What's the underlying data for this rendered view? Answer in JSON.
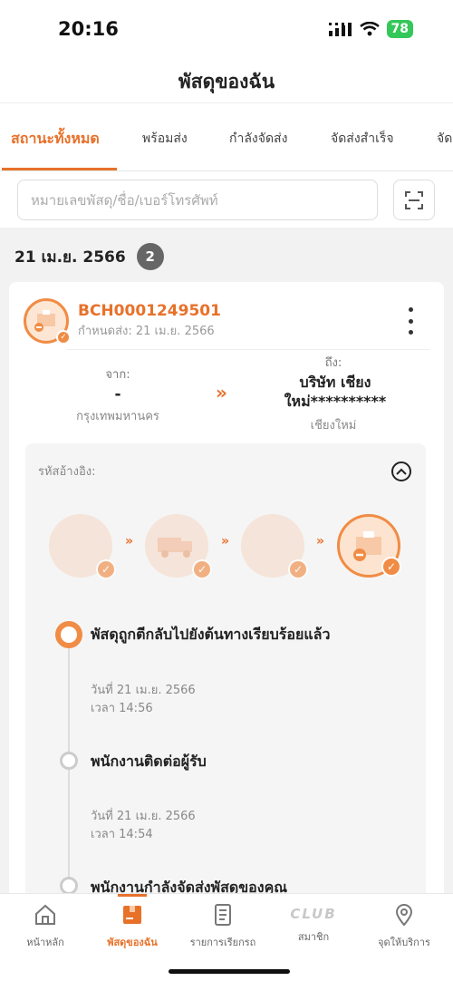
{
  "status_bar": {
    "time": "20:16",
    "battery": "78"
  },
  "header": {
    "title": "พัสดุของฉัน"
  },
  "tabs": [
    {
      "label": "สถานะทั้งหมด",
      "active": true
    },
    {
      "label": "พร้อมส่ง"
    },
    {
      "label": "กำลังจัดส่ง"
    },
    {
      "label": "จัดส่งสำเร็จ"
    },
    {
      "label": "จัด"
    }
  ],
  "search": {
    "placeholder": "หมายเลขพัสดุ/ชื่อ/เบอร์โทรศัพท์"
  },
  "group": {
    "date": "21 เม.ย. 2566",
    "count": "2"
  },
  "parcel": {
    "tracking": "BCH0001249501",
    "due": "กำหนดส่ง: 21 เม.ย. 2566",
    "from_label": "จาก:",
    "from_value": "-",
    "from_city": "กรุงเทพมหานคร",
    "to_label": "ถึง:",
    "to_value": "บริษัท เชียง ใหม่**********",
    "to_city": "เชียงใหม่",
    "ref_label": "รหัสอ้างอิง:",
    "events": [
      {
        "title": "พัสดุถูกตีกลับไปยังต้นทางเรียบร้อยแล้ว",
        "date": "วันที่ 21 เม.ย. 2566",
        "time": "เวลา 14:56"
      },
      {
        "title": "พนักงานติดต่อผู้รับ",
        "date": "วันที่ 21 เม.ย. 2566",
        "time": "เวลา 14:54"
      },
      {
        "title": "พนักงานกำลังจัดส่งพัสดุของคุณ"
      }
    ]
  },
  "bottom_nav": [
    {
      "label": "หน้าหลัก",
      "icon": "home-icon"
    },
    {
      "label": "พัสดุของฉัน",
      "icon": "parcel-icon",
      "active": true
    },
    {
      "label": "รายการเรียกรถ",
      "icon": "document-icon"
    },
    {
      "label": "สมาชิก",
      "icon": "club-icon",
      "text": "CLUB"
    },
    {
      "label": "จุดให้บริการ",
      "icon": "location-pin-icon"
    }
  ],
  "colors": {
    "accent": "#e8712a",
    "battery": "#34c759"
  }
}
